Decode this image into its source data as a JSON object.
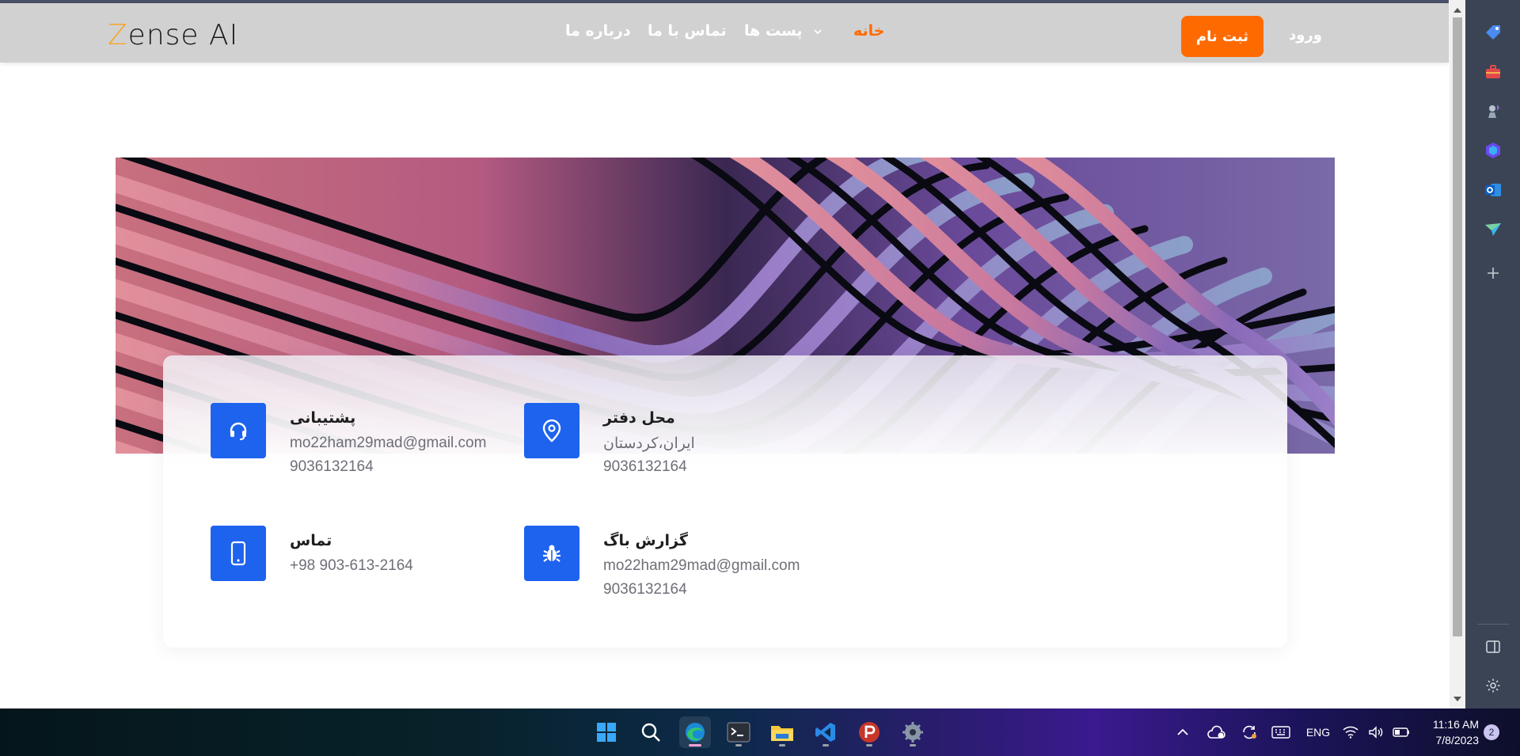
{
  "brand": {
    "logo_first": "Z",
    "logo_rest": "ense AI"
  },
  "nav": {
    "home": "خانه",
    "posts": "پست ها",
    "contact": "تماس با ما",
    "about": "درباره ما",
    "signup": "ثبت نام",
    "login": "ورود"
  },
  "contact_info": {
    "support": {
      "title": "پشتیبانی",
      "email": "mo22ham29mad@gmail.com",
      "phone": "9036132164",
      "icon": "headset-icon"
    },
    "office": {
      "title": "محل دفتر",
      "address": "ایران،کردستان",
      "phone": "9036132164",
      "icon": "location-pin-icon"
    },
    "call": {
      "title": "تماس",
      "phone": "+98 903-613-2164",
      "icon": "mobile-phone-icon"
    },
    "bug_report": {
      "title": "گزارش باگ",
      "email": "mo22ham29mad@gmail.com",
      "phone": "9036132164",
      "icon": "bug-icon"
    }
  },
  "taskbar": {
    "language": "ENG",
    "time": "11:16 AM",
    "date": "7/8/2023",
    "notifications": "2"
  },
  "colors": {
    "accent_orange": "#ff6a00",
    "icon_blue": "#1e63ee",
    "navbar_bg": "#d1d1d1",
    "sidepanel_bg": "#3b4455"
  }
}
